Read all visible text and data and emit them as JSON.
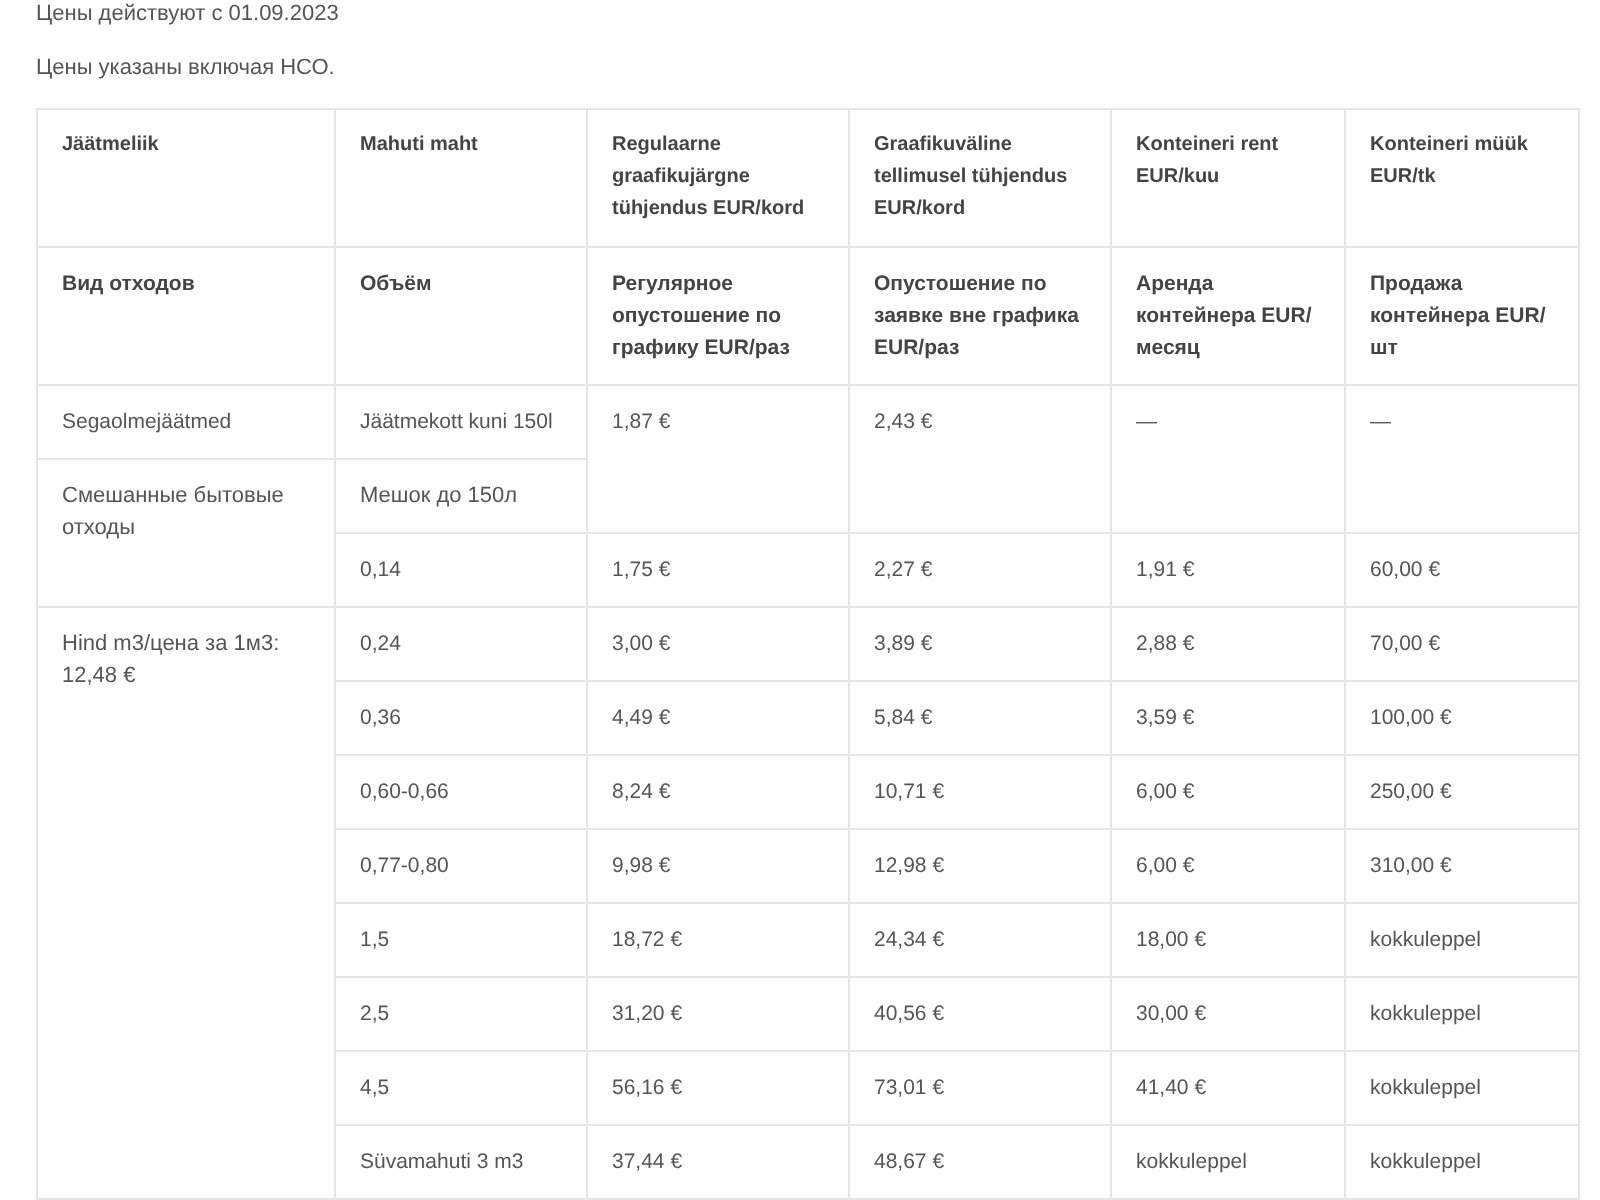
{
  "notes": [
    "Цены действуют с 01.09.2023",
    "Цены указаны включая НСО."
  ],
  "table": {
    "columns_et": [
      "Jäätmeliik",
      "Mahuti maht",
      "Regulaarne graafikujärgne tühjendus EUR/kord",
      "Graafikuväline tellimusel tühjendus EUR/kord",
      "Konteineri rent EUR/kuu",
      "Konteineri müük EUR/tk"
    ],
    "columns_ru": [
      "Вид отходов",
      "Объём",
      "Регулярное опустошение по графику EUR/раз",
      "Опустошение по заявке вне графика EUR/раз",
      "Аренда контейнера EUR/месяц",
      "Продажа контейнера EUR/шт"
    ],
    "bag_row": {
      "waste_type_et": "Segaolmejäätmed",
      "waste_type_ru": "Смешанные бытовые отходы",
      "size_et": "Jäätmekott kuni 150l",
      "size_ru": "Мешок до 150л",
      "prices": [
        "1,87 €",
        "2,43 €",
        "—",
        "—"
      ]
    },
    "bag_group_rows": [
      {
        "size": "0,14",
        "prices": [
          "1,75 €",
          "2,27 €",
          "1,91 €",
          "60,00 €"
        ]
      }
    ],
    "volume_group": {
      "label": "Hind m3/цена за 1м3: 12,48 €",
      "rows": [
        {
          "size": "0,24",
          "prices": [
            "3,00 €",
            "3,89 €",
            "2,88 €",
            "70,00 €"
          ]
        },
        {
          "size": "0,36",
          "prices": [
            "4,49 €",
            "5,84 €",
            "3,59 €",
            "100,00 €"
          ]
        },
        {
          "size": "0,60-0,66",
          "prices": [
            "8,24 €",
            "10,71 €",
            "6,00 €",
            "250,00 €"
          ]
        },
        {
          "size": "0,77-0,80",
          "prices": [
            "9,98 €",
            "12,98 €",
            "6,00 €",
            "310,00 €"
          ]
        },
        {
          "size": "1,5",
          "prices": [
            "18,72 €",
            "24,34 €",
            "18,00 €",
            "kokkuleppel"
          ]
        },
        {
          "size": "2,5",
          "prices": [
            "31,20 €",
            "40,56 €",
            "30,00 €",
            "kokkuleppel"
          ]
        },
        {
          "size": "4,5",
          "prices": [
            "56,16 €",
            "73,01 €",
            "41,40 €",
            "kokkuleppel"
          ]
        },
        {
          "size": "Süvamahuti 3 m3",
          "prices": [
            "37,44 €",
            "48,67 €",
            "kokkuleppel",
            "kokkuleppel"
          ]
        }
      ]
    }
  }
}
